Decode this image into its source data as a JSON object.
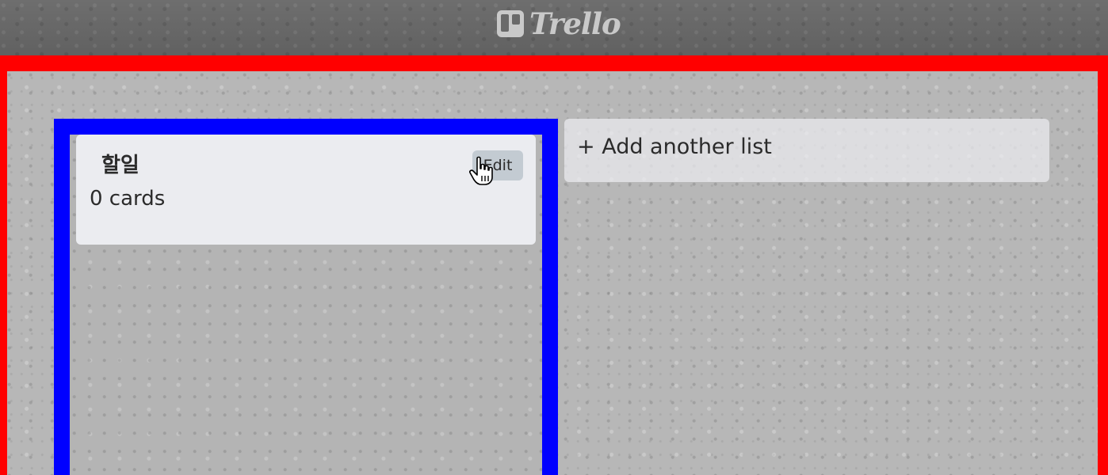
{
  "app": {
    "name": "Trello",
    "logo_icon": "trello-board-icon"
  },
  "board": {
    "frame_color": "#ff0000",
    "lists": [
      {
        "title": "할일",
        "count_text": "0 cards",
        "edit_label": "Edit",
        "frame_color": "#0000ff"
      }
    ],
    "add_list_label": "+ Add another list"
  },
  "cursor": {
    "icon": "hand-pointer-icon"
  }
}
